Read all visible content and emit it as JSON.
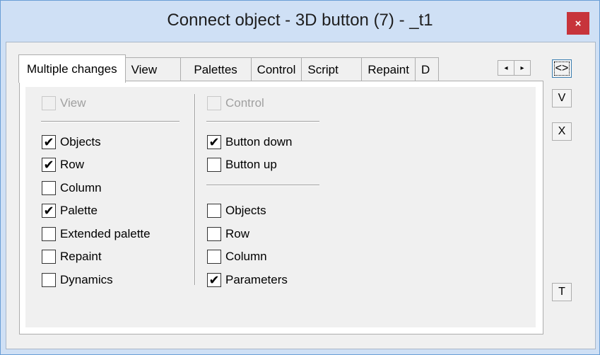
{
  "window": {
    "title": "Connect object - 3D button (7) - _t1",
    "close_label": "×"
  },
  "tabs": [
    {
      "label": "Multiple changes",
      "active": true
    },
    {
      "label": "View"
    },
    {
      "label": "Palettes"
    },
    {
      "label": "Control"
    },
    {
      "label": "Script"
    },
    {
      "label": "Repaint"
    },
    {
      "label": "D"
    }
  ],
  "tab_scroll": {
    "left": "◂",
    "right": "▸"
  },
  "left_group": {
    "header": {
      "label": "View",
      "checked": false,
      "disabled": true
    },
    "items": [
      {
        "label": "Objects",
        "checked": true
      },
      {
        "label": "Row",
        "checked": true
      },
      {
        "label": "Column",
        "checked": false
      },
      {
        "label": "Palette",
        "checked": true
      },
      {
        "label": "Extended palette",
        "checked": false
      },
      {
        "label": "Repaint",
        "checked": false
      },
      {
        "label": "Dynamics",
        "checked": false
      }
    ]
  },
  "right_group": {
    "header": {
      "label": "Control",
      "checked": false,
      "disabled": true
    },
    "items_top": [
      {
        "label": "Button down",
        "checked": true
      },
      {
        "label": "Button up",
        "checked": false
      }
    ],
    "items_bottom": [
      {
        "label": "Objects",
        "checked": false
      },
      {
        "label": "Row",
        "checked": false
      },
      {
        "label": "Column",
        "checked": false
      },
      {
        "label": "Parameters",
        "checked": true
      }
    ]
  },
  "side_buttons": {
    "swap": "<>",
    "v": "V",
    "x": "X",
    "t": "T"
  },
  "check_glyph": "✔"
}
